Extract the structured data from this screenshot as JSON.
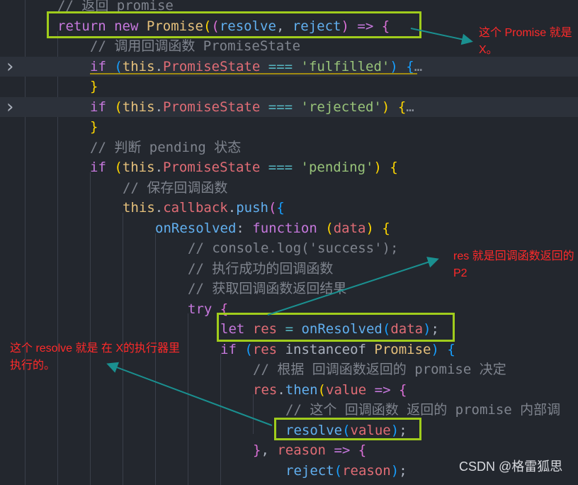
{
  "editor": {
    "lines": [
      {
        "indent": 0,
        "tokens": [
          [
            "// 返回 promise",
            "cm"
          ]
        ]
      },
      {
        "indent": 0,
        "tokens": [
          [
            "return",
            "kw"
          ],
          [
            " ",
            "pl"
          ],
          [
            "new",
            "kw"
          ],
          [
            " ",
            "pl"
          ],
          [
            "Promise",
            "cls"
          ],
          [
            "(",
            "b1"
          ],
          [
            "(",
            "b2"
          ],
          [
            "resolve",
            "prm"
          ],
          [
            ", ",
            "pl"
          ],
          [
            "reject",
            "prm"
          ],
          [
            ")",
            "b2"
          ],
          [
            " ",
            "pl"
          ],
          [
            "=>",
            "kw"
          ],
          [
            " ",
            "pl"
          ],
          [
            "{",
            "b2"
          ]
        ]
      },
      {
        "indent": 1,
        "tokens": [
          [
            "// 调用回调函数 PromiseState",
            "cm"
          ]
        ]
      },
      {
        "indent": 1,
        "folded": true,
        "tokens": [
          [
            "if",
            "kw"
          ],
          [
            " ",
            "pl"
          ],
          [
            "(",
            "b3"
          ],
          [
            "this",
            "this"
          ],
          [
            ".",
            "pl"
          ],
          [
            "PromiseState",
            "prop"
          ],
          [
            " ",
            "pl"
          ],
          [
            "===",
            "op"
          ],
          [
            " ",
            "pl"
          ],
          [
            "'fulfilled'",
            "str"
          ],
          [
            ")",
            "b3"
          ],
          [
            " ",
            "pl"
          ],
          [
            "{",
            "b3"
          ],
          [
            "…",
            "dots"
          ]
        ]
      },
      {
        "indent": 1,
        "tokens": [
          [
            "}",
            "b1"
          ]
        ]
      },
      {
        "indent": 1,
        "folded": true,
        "tokens": [
          [
            "if",
            "kw"
          ],
          [
            " ",
            "pl"
          ],
          [
            "(",
            "b1"
          ],
          [
            "this",
            "this"
          ],
          [
            ".",
            "pl"
          ],
          [
            "PromiseState",
            "prop"
          ],
          [
            " ",
            "pl"
          ],
          [
            "===",
            "op"
          ],
          [
            " ",
            "pl"
          ],
          [
            "'rejected'",
            "str"
          ],
          [
            ")",
            "b1"
          ],
          [
            " ",
            "pl"
          ],
          [
            "{",
            "b1"
          ],
          [
            "…",
            "dots"
          ]
        ]
      },
      {
        "indent": 1,
        "tokens": [
          [
            "}",
            "b1"
          ]
        ]
      },
      {
        "indent": 1,
        "tokens": [
          [
            "// 判断 pending 状态",
            "cm"
          ]
        ]
      },
      {
        "indent": 1,
        "tokens": [
          [
            "if",
            "kw"
          ],
          [
            " ",
            "pl"
          ],
          [
            "(",
            "b1"
          ],
          [
            "this",
            "this"
          ],
          [
            ".",
            "pl"
          ],
          [
            "PromiseState",
            "prop"
          ],
          [
            " ",
            "pl"
          ],
          [
            "===",
            "op"
          ],
          [
            " ",
            "pl"
          ],
          [
            "'pending'",
            "str"
          ],
          [
            ")",
            "b1"
          ],
          [
            " ",
            "pl"
          ],
          [
            "{",
            "b1"
          ]
        ]
      },
      {
        "indent": 2,
        "tokens": [
          [
            "// 保存回调函数",
            "cm"
          ]
        ]
      },
      {
        "indent": 2,
        "tokens": [
          [
            "this",
            "this"
          ],
          [
            ".",
            "pl"
          ],
          [
            "callback",
            "prop"
          ],
          [
            ".",
            "pl"
          ],
          [
            "push",
            "fn"
          ],
          [
            "(",
            "b2"
          ],
          [
            "{",
            "b3"
          ]
        ]
      },
      {
        "indent": 3,
        "tokens": [
          [
            "onResolved",
            "fn"
          ],
          [
            ": ",
            "pl"
          ],
          [
            "function",
            "kw"
          ],
          [
            " ",
            "pl"
          ],
          [
            "(",
            "b1"
          ],
          [
            "data",
            "var"
          ],
          [
            ")",
            "b1"
          ],
          [
            " ",
            "pl"
          ],
          [
            "{",
            "b1"
          ]
        ]
      },
      {
        "indent": 4,
        "tokens": [
          [
            "// console.log('success');",
            "cm"
          ]
        ]
      },
      {
        "indent": 4,
        "tokens": [
          [
            "// 执行成功的回调函数",
            "cm"
          ]
        ]
      },
      {
        "indent": 4,
        "tokens": [
          [
            "// 获取回调函数返回结果",
            "cm"
          ]
        ]
      },
      {
        "indent": 4,
        "tokens": [
          [
            "try",
            "kw"
          ],
          [
            " ",
            "pl"
          ],
          [
            "{",
            "b2"
          ]
        ]
      },
      {
        "indent": 5,
        "tokens": [
          [
            "let",
            "kw"
          ],
          [
            " ",
            "pl"
          ],
          [
            "res",
            "var"
          ],
          [
            " ",
            "pl"
          ],
          [
            "=",
            "op"
          ],
          [
            " ",
            "pl"
          ],
          [
            "onResolved",
            "fn"
          ],
          [
            "(",
            "b3"
          ],
          [
            "data",
            "var"
          ],
          [
            ")",
            "b3"
          ],
          [
            ";",
            "pl"
          ]
        ]
      },
      {
        "indent": 5,
        "tokens": [
          [
            "if",
            "kw"
          ],
          [
            " ",
            "pl"
          ],
          [
            "(",
            "b3"
          ],
          [
            "res",
            "var"
          ],
          [
            " ",
            "pl"
          ],
          [
            "instanceof",
            "pl"
          ],
          [
            " ",
            "pl"
          ],
          [
            "Promise",
            "cls"
          ],
          [
            ")",
            "b3"
          ],
          [
            " ",
            "pl"
          ],
          [
            "{",
            "b3"
          ]
        ]
      },
      {
        "indent": 6,
        "tokens": [
          [
            "// 根据 回调函数返回的 promise 决定",
            "cm"
          ]
        ]
      },
      {
        "indent": 6,
        "tokens": [
          [
            "res",
            "var"
          ],
          [
            ".",
            "pl"
          ],
          [
            "then",
            "fn"
          ],
          [
            "(",
            "b1"
          ],
          [
            "value",
            "var"
          ],
          [
            " ",
            "pl"
          ],
          [
            "=>",
            "kw"
          ],
          [
            " ",
            "pl"
          ],
          [
            "{",
            "b2"
          ]
        ]
      },
      {
        "indent": 7,
        "tokens": [
          [
            "// 这个 回调函数 返回的 promise 内部调",
            "cm"
          ]
        ]
      },
      {
        "indent": 7,
        "tokens": [
          [
            "resolve",
            "fn"
          ],
          [
            "(",
            "b3"
          ],
          [
            "value",
            "var"
          ],
          [
            ")",
            "b3"
          ],
          [
            ";",
            "pl"
          ]
        ]
      },
      {
        "indent": 6,
        "tokens": [
          [
            "}",
            "b2"
          ],
          [
            ", ",
            "pl"
          ],
          [
            "reason",
            "var"
          ],
          [
            " ",
            "pl"
          ],
          [
            "=>",
            "kw"
          ],
          [
            " ",
            "pl"
          ],
          [
            "{",
            "b2"
          ]
        ]
      },
      {
        "indent": 7,
        "tokens": [
          [
            "reject",
            "fn"
          ],
          [
            "(",
            "b3"
          ],
          [
            "reason",
            "var"
          ],
          [
            ")",
            "b3"
          ],
          [
            ";",
            "pl"
          ]
        ]
      }
    ]
  },
  "annotations": {
    "note1": "这个 Promise 就是 X。",
    "note2": "res 就是回调函数返回的 P2",
    "note3": "这个 resolve 就是 在 X的执行器里执行的。",
    "box_color": "#a0cc1c",
    "arrow_color": "#1a9090",
    "text_color": "#ff2a2a"
  },
  "watermark": "CSDN @格雷狐思",
  "icons": {
    "fold": "chevron-right-icon"
  }
}
